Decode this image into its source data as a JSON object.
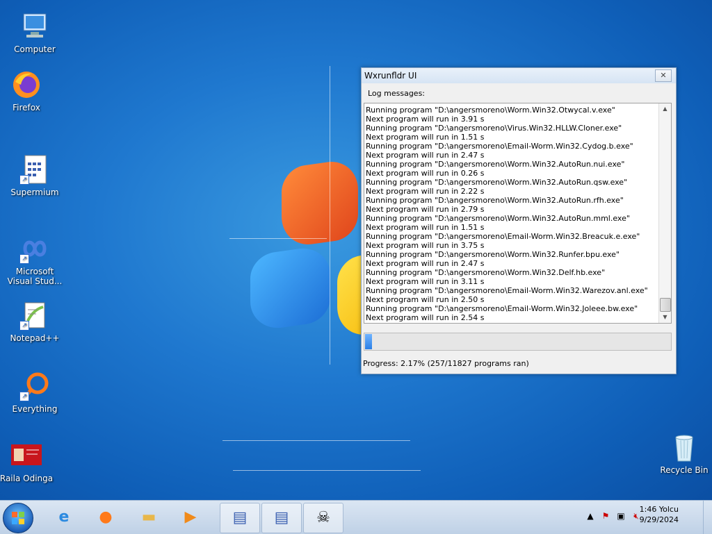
{
  "desktop": {
    "icons": [
      {
        "label": "Computer"
      },
      {
        "label": "Firefox"
      },
      {
        "label": "Supermium"
      },
      {
        "label": "Microsoft Visual Stud..."
      },
      {
        "label": "Notepad++"
      },
      {
        "label": "Everything"
      },
      {
        "label": "Raila Odinga"
      }
    ],
    "recycle_bin": {
      "label": "Recycle Bin"
    }
  },
  "window": {
    "title": "Wxrunfldr UI",
    "log_label": "Log messages:",
    "log_lines": [
      "Running program \"D:\\angersmoreno\\Worm.Win32.Otwycal.v.exe\"",
      "Next program will run in 3.91 s",
      "Running program \"D:\\angersmoreno\\Virus.Win32.HLLW.Cloner.exe\"",
      "Next program will run in 1.51 s",
      "Running program \"D:\\angersmoreno\\Email-Worm.Win32.Cydog.b.exe\"",
      "Next program will run in 2.47 s",
      "Running program \"D:\\angersmoreno\\Worm.Win32.AutoRun.nui.exe\"",
      "Next program will run in 0.26 s",
      "Running program \"D:\\angersmoreno\\Worm.Win32.AutoRun.qsw.exe\"",
      "Next program will run in 2.22 s",
      "Running program \"D:\\angersmoreno\\Worm.Win32.AutoRun.rfh.exe\"",
      "Next program will run in 2.79 s",
      "Running program \"D:\\angersmoreno\\Worm.Win32.AutoRun.mml.exe\"",
      "Next program will run in 1.51 s",
      "Running program \"D:\\angersmoreno\\Email-Worm.Win32.Breacuk.e.exe\"",
      "Next program will run in 3.75 s",
      "Running program \"D:\\angersmoreno\\Worm.Win32.Runfer.bpu.exe\"",
      "Next program will run in 2.47 s",
      "Running program \"D:\\angersmoreno\\Worm.Win32.Delf.hb.exe\"",
      "Next program will run in 3.11 s",
      "Running program \"D:\\angersmoreno\\Email-Worm.Win32.Warezov.anl.exe\"",
      "Next program will run in 2.50 s",
      "Running program \"D:\\angersmoreno\\Email-Worm.Win32.Joleee.bw.exe\"",
      "Next program will run in 2.54 s"
    ],
    "progress_fraction": 0.0217,
    "progress_text": "Progress: 2.17% (257/11827 programs ran)"
  },
  "taskbar": {
    "clock_time": "1:46 Yolcu",
    "clock_date": "9/29/2024"
  },
  "icon_names": [
    "computer-icon",
    "firefox-icon",
    "supermium-icon",
    "visual-studio-icon",
    "notepadpp-icon",
    "everything-icon",
    "raila-odinga-icon",
    "recycle-bin-icon"
  ],
  "colors": {
    "accent": "#2a7fe6",
    "desktop": "#1f78cf",
    "taskbar": "#cfdcec"
  }
}
